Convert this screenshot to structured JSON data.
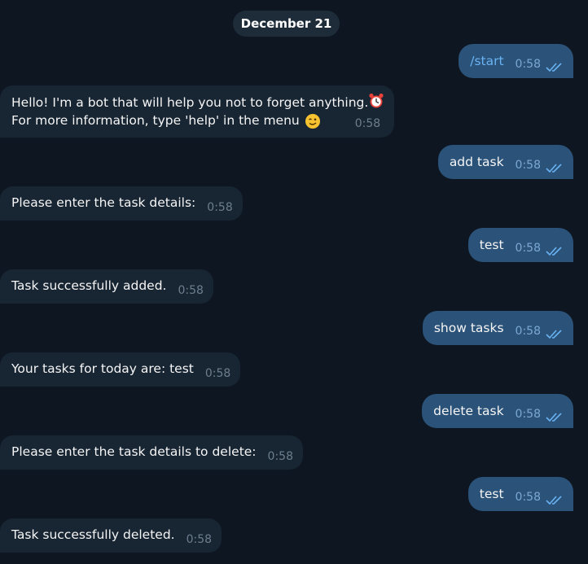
{
  "chat": {
    "date": "December 21",
    "messages": [
      {
        "dir": "out",
        "text": "/start",
        "time": "0:58",
        "is_command": true
      },
      {
        "dir": "in",
        "line1": "Hello! I'm a bot that will help you not to forget anything.",
        "line2": "For more information, type 'help' in the menu",
        "time": "0:58"
      },
      {
        "dir": "out",
        "text": "add task",
        "time": "0:58"
      },
      {
        "dir": "in",
        "text": "Please enter the task details:",
        "time": "0:58"
      },
      {
        "dir": "out",
        "text": "test",
        "time": "0:58"
      },
      {
        "dir": "in",
        "text": "Task successfully added.",
        "time": "0:58"
      },
      {
        "dir": "out",
        "text": "show tasks",
        "time": "0:58"
      },
      {
        "dir": "in",
        "text": "Your tasks for today are: test",
        "time": "0:58"
      },
      {
        "dir": "out",
        "text": "delete task",
        "time": "0:58"
      },
      {
        "dir": "in",
        "text": "Please enter the task details to delete:",
        "time": "0:58"
      },
      {
        "dir": "out",
        "text": "test",
        "time": "0:58"
      },
      {
        "dir": "in",
        "text": "Task successfully deleted.",
        "time": "0:58"
      }
    ]
  },
  "icons": {
    "read_receipt": "double-check-icon",
    "alarm": "alarm-clock-emoji",
    "wink": "winking-face-emoji"
  },
  "colors": {
    "background": "#0e1621",
    "incoming_bubble": "#182533",
    "outgoing_bubble": "#2b5278",
    "command_link": "#6ab3f3",
    "read_check": "#6ab3f3"
  }
}
